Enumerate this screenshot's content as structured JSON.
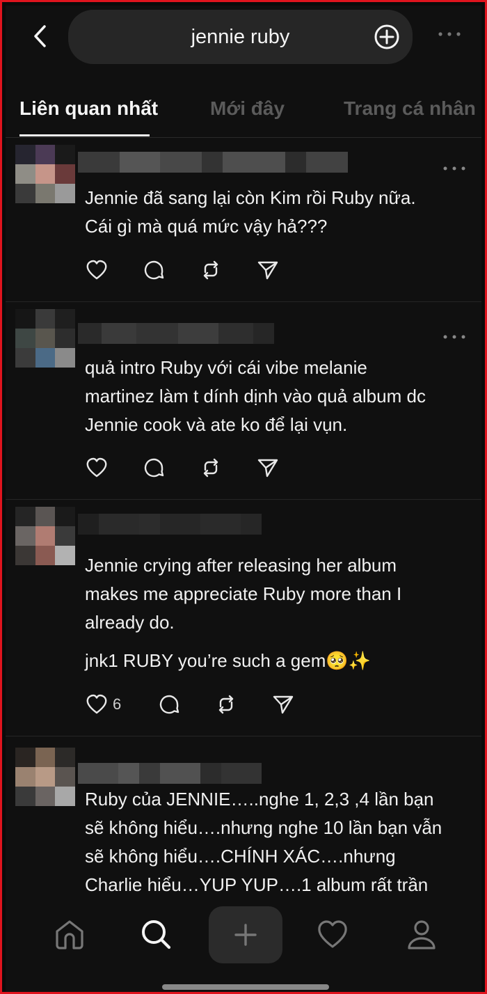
{
  "search": {
    "query": "jennie ruby"
  },
  "tabs": [
    {
      "label": "Liên quan nhất",
      "active": true
    },
    {
      "label": "Mới đây",
      "active": false
    },
    {
      "label": "Trang cá nhân",
      "active": false
    }
  ],
  "posts": [
    {
      "lines": [
        "Jennie đã sang lại còn Kim rồi Ruby nữa.",
        "Cái gì mà quá mức vậy hả???"
      ],
      "extra": "",
      "like_count": ""
    },
    {
      "lines": [
        "quả intro Ruby với cái vibe melanie",
        "martinez làm t dính dịnh vào quả album dc",
        "Jennie cook và ate ko để lại vụn."
      ],
      "extra": "",
      "like_count": ""
    },
    {
      "lines": [
        "Jennie crying after releasing her album",
        "makes me appreciate Ruby more than I",
        "already do."
      ],
      "extra": "jnk1 RUBY you’re such a gem🥺✨",
      "like_count": "6"
    },
    {
      "lines": [
        "Ruby của JENNIE…..nghe 1, 2,3 ,4 lần bạn",
        "sẽ không hiểu….nhưng nghe 10 lần bạn vẫn",
        "sẽ không hiểu….CHÍNH XÁC….nhưng",
        "Charlie hiểu…YUP YUP….1 album rất trần"
      ],
      "extra": "",
      "like_count": ""
    }
  ],
  "icons": {
    "back": "chevron-left-icon",
    "plus": "plus-circle-icon",
    "more": "more-horizontal-icon",
    "like": "heart-icon",
    "reply": "comment-icon",
    "repost": "repost-icon",
    "share": "send-icon",
    "nav": [
      "home-icon",
      "search-icon",
      "create-icon",
      "activity-icon",
      "profile-icon"
    ]
  },
  "colors": {
    "background": "#101010",
    "border": "#e0141e",
    "text": "#f3f3f3",
    "muted": "#5b5b5b"
  }
}
